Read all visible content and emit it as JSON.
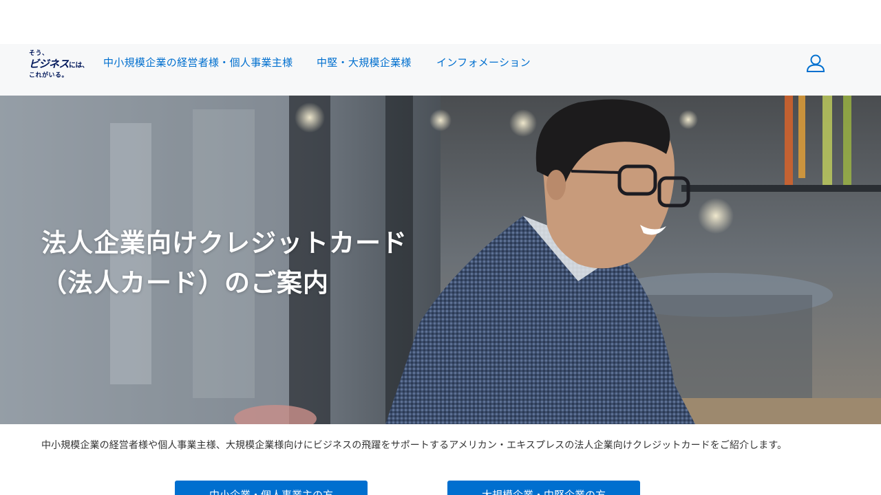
{
  "logo": {
    "line1": "そう、",
    "line2": "ビジネス",
    "line2_suffix": "には、",
    "line3": "これがいる。"
  },
  "nav": {
    "items": [
      {
        "label": "中小規模企業の経営者様・個人事業主様"
      },
      {
        "label": "中堅・大規模企業様"
      },
      {
        "label": "インフォメーション"
      }
    ]
  },
  "hero": {
    "title_line1": "法人企業向けクレジットカード",
    "title_line2": "（法人カード）のご案内"
  },
  "intro": {
    "text": "中小規模企業の経営者様や個人事業主様、大規模企業様向けにビジネスの飛躍をサポートするアメリカン・エキスプレスの法人企業向けクレジットカードをご紹介します。"
  },
  "cta": {
    "small_business_label": "中小企業・個人事業主の方",
    "large_business_label": "大規模企業・中堅企業の方"
  },
  "colors": {
    "brand_blue": "#006fcf",
    "logo_navy": "#00175a",
    "header_bg": "#f7f8f9"
  },
  "icons": {
    "account": "user-icon"
  }
}
